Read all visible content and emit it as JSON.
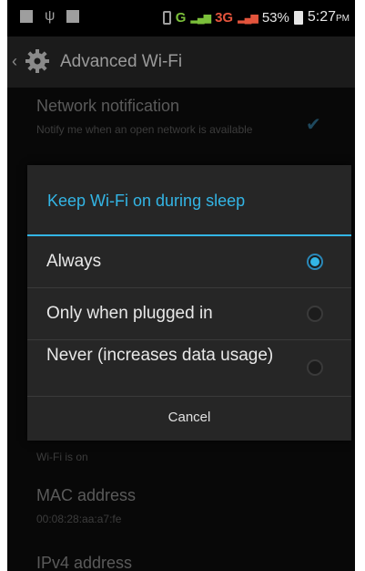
{
  "status_bar": {
    "battery_percent": "53%",
    "time": "5:27",
    "ampm": "PM",
    "network_g": "G",
    "network_3g": "3G"
  },
  "action_bar": {
    "title": "Advanced Wi-Fi"
  },
  "settings": {
    "network_notification": {
      "title": "Network notification",
      "summary": "Notify me when an open network is available",
      "checked": true
    },
    "wifi_on_summary": "Wi-Fi is on",
    "mac_address": {
      "title": "MAC address",
      "value": "00:08:28:aa:a7:fe"
    },
    "ipv4_address": {
      "title": "IPv4 address"
    }
  },
  "dialog": {
    "title": "Keep Wi-Fi on during sleep",
    "options": [
      {
        "label": "Always",
        "selected": true
      },
      {
        "label": "Only when plugged in",
        "selected": false
      },
      {
        "label": "Never (increases data usage)",
        "selected": false
      }
    ],
    "cancel_label": "Cancel"
  },
  "colors": {
    "accent": "#33b5e5",
    "background": "#0d0d0d",
    "dialog": "#262626"
  }
}
